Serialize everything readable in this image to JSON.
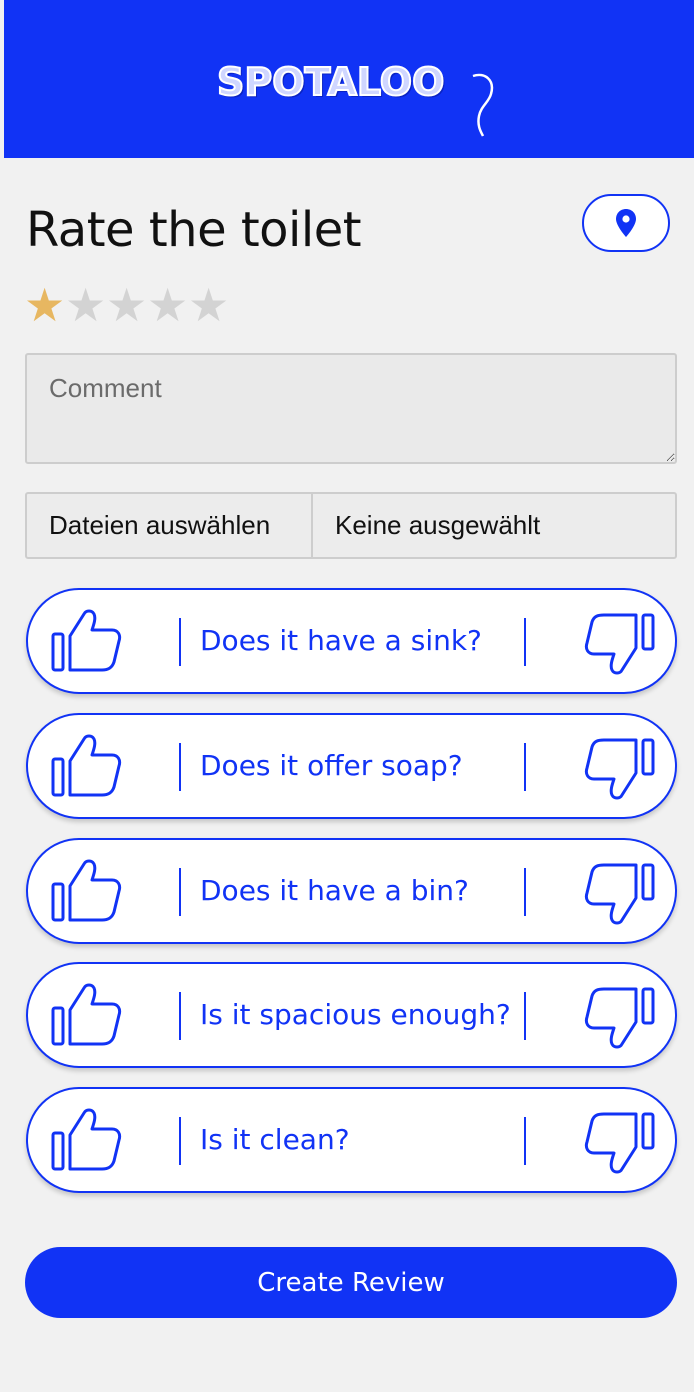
{
  "header": {
    "logo_text": "SPOTALOO",
    "background": "#1133f5"
  },
  "page": {
    "title": "Rate the toilet",
    "location_icon": "map-pin-icon"
  },
  "rating": {
    "value": 1,
    "max": 5,
    "filled_color": "#e7b761",
    "empty_color": "#d3d3d3"
  },
  "comment": {
    "placeholder": "Comment",
    "value": ""
  },
  "file_upload": {
    "button_label": "Dateien auswählen",
    "status": "Keine ausgewählt"
  },
  "questions": [
    {
      "label": "Does it have a sink?",
      "up_icon": "thumbs-up-icon",
      "down_icon": "thumbs-down-icon"
    },
    {
      "label": "Does it offer soap?",
      "up_icon": "thumbs-up-icon",
      "down_icon": "thumbs-down-icon"
    },
    {
      "label": "Does it have a bin?",
      "up_icon": "thumbs-up-icon",
      "down_icon": "thumbs-down-icon"
    },
    {
      "label": "Is it spacious enough?",
      "up_icon": "thumbs-up-icon",
      "down_icon": "thumbs-down-icon"
    },
    {
      "label": "Is it clean?",
      "up_icon": "thumbs-up-icon",
      "down_icon": "thumbs-down-icon"
    }
  ],
  "submit": {
    "label": "Create Review"
  },
  "colors": {
    "accent": "#1133f5",
    "background": "#f1f1f1"
  }
}
